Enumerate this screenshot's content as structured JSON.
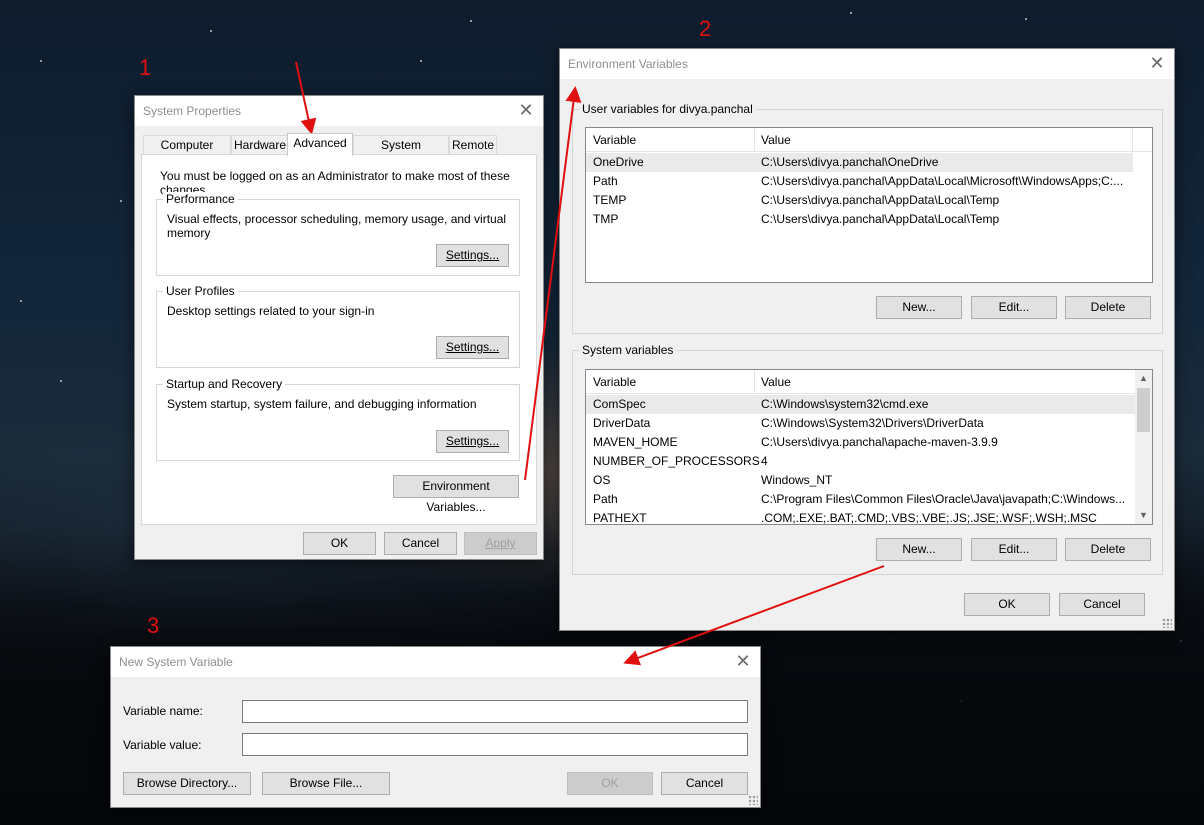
{
  "annotations": {
    "step1": "1",
    "step2": "2",
    "step3": "3"
  },
  "system_properties": {
    "title": "System Properties",
    "tabs": [
      "Computer Name",
      "Hardware",
      "Advanced",
      "System Protection",
      "Remote"
    ],
    "active_tab": "Advanced",
    "admin_note": "You must be logged on as an Administrator to make most of these changes.",
    "performance": {
      "legend": "Performance",
      "description": "Visual effects, processor scheduling, memory usage, and virtual memory",
      "settings_label": "Settings..."
    },
    "user_profiles": {
      "legend": "User Profiles",
      "description": "Desktop settings related to your sign-in",
      "settings_label": "Settings..."
    },
    "startup_recovery": {
      "legend": "Startup and Recovery",
      "description": "System startup, system failure, and debugging information",
      "settings_label": "Settings..."
    },
    "env_vars_label": "Environment Variables...",
    "ok_label": "OK",
    "cancel_label": "Cancel",
    "apply_label": "Apply"
  },
  "environment_variables": {
    "title": "Environment Variables",
    "user_group_label": "User variables for divya.panchal",
    "columns": [
      "Variable",
      "Value"
    ],
    "user_vars": [
      {
        "name": "OneDrive",
        "value": "C:\\Users\\divya.panchal\\OneDrive"
      },
      {
        "name": "Path",
        "value": "C:\\Users\\divya.panchal\\AppData\\Local\\Microsoft\\WindowsApps;C:..."
      },
      {
        "name": "TEMP",
        "value": "C:\\Users\\divya.panchal\\AppData\\Local\\Temp"
      },
      {
        "name": "TMP",
        "value": "C:\\Users\\divya.panchal\\AppData\\Local\\Temp"
      }
    ],
    "system_group_label": "System variables",
    "system_vars": [
      {
        "name": "ComSpec",
        "value": "C:\\Windows\\system32\\cmd.exe"
      },
      {
        "name": "DriverData",
        "value": "C:\\Windows\\System32\\Drivers\\DriverData"
      },
      {
        "name": "MAVEN_HOME",
        "value": "C:\\Users\\divya.panchal\\apache-maven-3.9.9"
      },
      {
        "name": "NUMBER_OF_PROCESSORS",
        "value": "4"
      },
      {
        "name": "OS",
        "value": "Windows_NT"
      },
      {
        "name": "Path",
        "value": "C:\\Program Files\\Common Files\\Oracle\\Java\\javapath;C:\\Windows..."
      },
      {
        "name": "PATHEXT",
        "value": ".COM;.EXE;.BAT;.CMD;.VBS;.VBE;.JS;.JSE;.WSF;.WSH;.MSC"
      }
    ],
    "new_label": "New...",
    "edit_label": "Edit...",
    "delete_label": "Delete",
    "ok_label": "OK",
    "cancel_label": "Cancel"
  },
  "new_system_variable": {
    "title": "New System Variable",
    "name_label": "Variable name:",
    "value_label": "Variable value:",
    "name_value": "",
    "value_value": "",
    "browse_dir_label": "Browse Directory...",
    "browse_file_label": "Browse File...",
    "ok_label": "OK",
    "cancel_label": "Cancel"
  },
  "colors": {
    "annotation_red": "#e01010",
    "dialog_bg": "#f0f0f0",
    "selection": "#eaeaea"
  }
}
